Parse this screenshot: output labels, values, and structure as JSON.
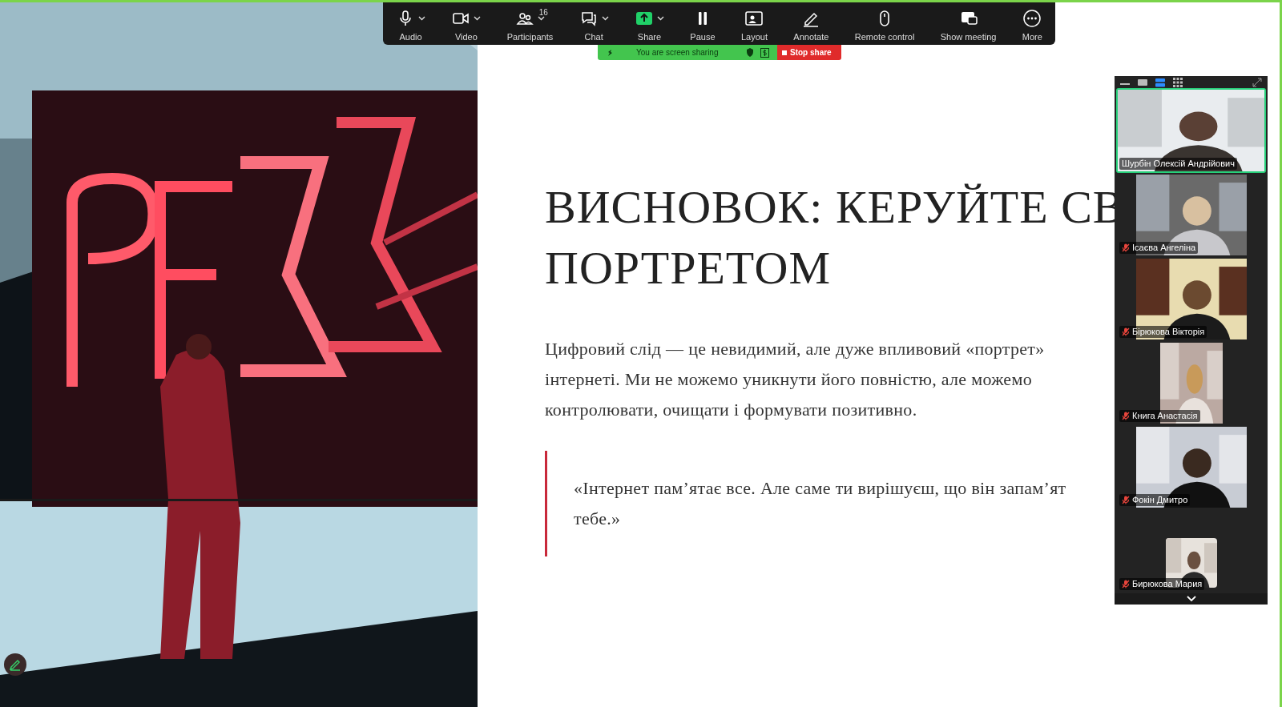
{
  "toolbar": {
    "items": [
      {
        "kind": "audio",
        "label": "Audio",
        "caret": true
      },
      {
        "kind": "video",
        "label": "Video",
        "caret": true
      },
      {
        "kind": "participants",
        "label": "Participants",
        "caret": true,
        "count": "16"
      },
      {
        "kind": "chat",
        "label": "Chat",
        "caret": true
      },
      {
        "kind": "share",
        "label": "Share",
        "caret": true
      },
      {
        "kind": "pause",
        "label": "Pause",
        "caret": false
      },
      {
        "kind": "layout",
        "label": "Layout",
        "caret": false
      },
      {
        "kind": "annotate",
        "label": "Annotate",
        "caret": false
      },
      {
        "kind": "remote",
        "label": "Remote control",
        "caret": false
      },
      {
        "kind": "show",
        "label": "Show meeting",
        "caret": false
      },
      {
        "kind": "more",
        "label": "More",
        "caret": false
      }
    ]
  },
  "sharing_bar": {
    "status": "You are screen sharing",
    "stop_button": "Stop share"
  },
  "slide": {
    "title_lines": [
      "ВИСНОВОК: КЕРУЙТЕ СВ",
      "ПОРТРЕТОМ"
    ],
    "paragraph_lines": [
      "Цифровий слід — це невидимий, але дуже впливовий «портрет»",
      "інтернеті. Ми не можемо уникнути його повністю, але можемо",
      "контролювати, очищати і формувати позитивно."
    ],
    "quote_lines": [
      "«Інтернет пам’ятає все. Але саме ти вирішуєш, що він запам’ят",
      "тебе.»"
    ]
  },
  "gallery": {
    "view_buttons": [
      {
        "kind": "minimize",
        "selected": false
      },
      {
        "kind": "speaker",
        "selected": false
      },
      {
        "kind": "strip",
        "selected": true
      },
      {
        "kind": "grid",
        "selected": false
      }
    ],
    "tiles": [
      {
        "name": "Шурбін Олексій Андрійович",
        "muted": false,
        "speaking": true,
        "kind": "wide"
      },
      {
        "name": "Ісаєва Ангеліна",
        "muted": true,
        "speaking": false,
        "kind": "medium"
      },
      {
        "name": "Бірюкова Вікторія",
        "muted": true,
        "speaking": false,
        "kind": "medium"
      },
      {
        "name": "Книга Анастасія",
        "muted": true,
        "speaking": false,
        "kind": "narrow"
      },
      {
        "name": "Фокін Дмитро",
        "muted": true,
        "speaking": false,
        "kind": "medium"
      },
      {
        "name": "Бирюкова Мария",
        "muted": true,
        "speaking": false,
        "kind": "small"
      }
    ]
  }
}
